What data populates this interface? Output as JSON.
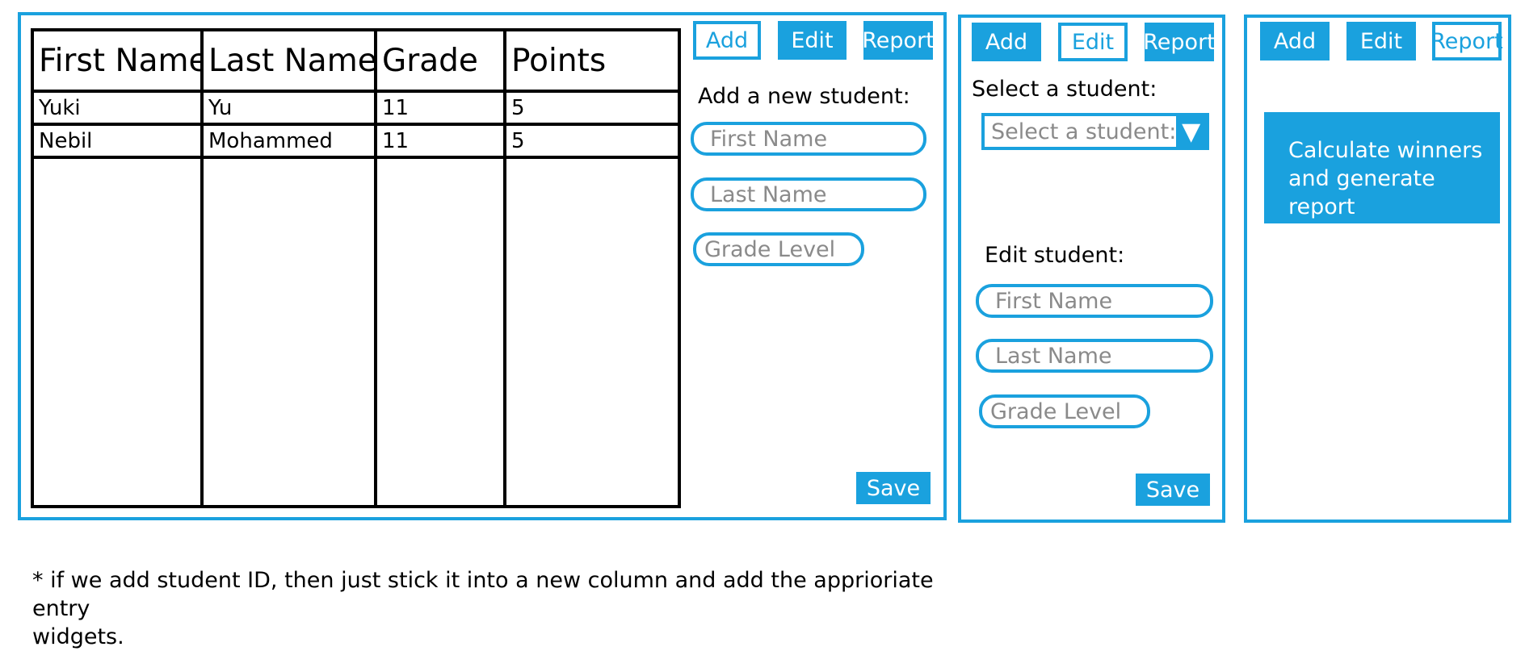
{
  "main_panel": {
    "columns": [
      "First Name",
      "Last Name",
      "Grade",
      "Points"
    ],
    "rows": [
      [
        "Yuki",
        "Yu",
        "11",
        "5"
      ],
      [
        "Nebil",
        "Mohammed",
        "11",
        "5"
      ]
    ]
  },
  "nav": {
    "add": "Add",
    "edit": "Edit",
    "report": "Report"
  },
  "add_panel": {
    "heading": "Add a new student:",
    "first_name_placeholder": "First Name",
    "last_name_placeholder": "Last Name",
    "grade_placeholder": "Grade Level",
    "save": "Save"
  },
  "edit_panel": {
    "select_heading": "Select a student:",
    "select_value": "Select a student:",
    "select_arrow": "▼",
    "edit_heading": "Edit student:",
    "first_name_placeholder": "First Name",
    "last_name_placeholder": "Last Name",
    "grade_placeholder": "Grade Level",
    "save": "Save"
  },
  "report_panel": {
    "button_line1": "Calculate winners",
    "button_line2": "and generate report"
  },
  "footnote": {
    "line1": "* if we add student ID, then just stick it into a new column and add the apprioriate entry",
    "line2": "widgets."
  },
  "colors": {
    "accent": "#1aa1de",
    "placeholder": "#8a8a8a"
  }
}
